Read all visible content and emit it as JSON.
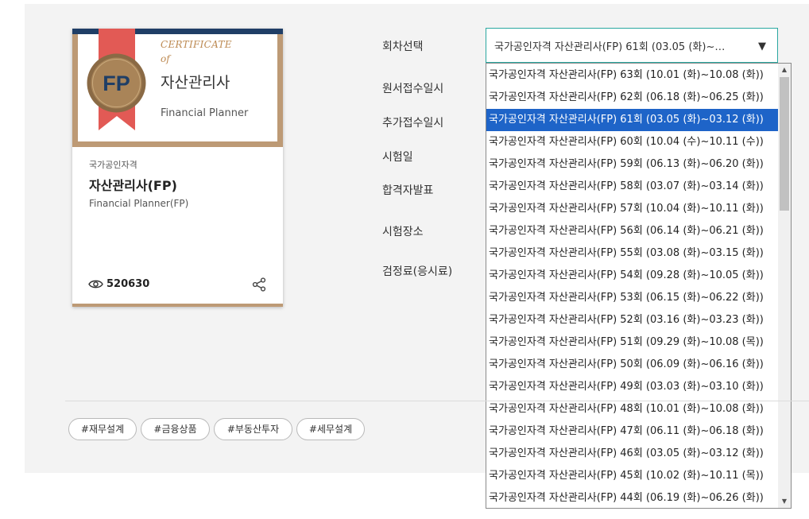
{
  "card": {
    "certificate_word": "CERTIFICATE",
    "of_word": "of",
    "seal_text": "FP",
    "title_ko": "자산관리사",
    "title_en": "Financial Planner",
    "category": "국가공인자격",
    "name": "자산관리사(FP)",
    "name_en": "Financial Planner(FP)",
    "views": "520630",
    "colors": {
      "navy": "#1f3e66",
      "gold": "#bd9a75",
      "ribbon": "#e25a55"
    }
  },
  "info_labels": [
    "회차선택",
    "원서접수일시",
    "추가접수일시",
    "시험일",
    "합격자발표",
    "시험장소",
    "검정료(응시료)"
  ],
  "round_select": {
    "selected_text": "국가공인자격 자산관리사(FP) 61회 (03.05 (화)~…",
    "options": [
      "국가공인자격 자산관리사(FP) 63회 (10.01 (화)~10.08 (화))",
      "국가공인자격 자산관리사(FP) 62회 (06.18 (화)~06.25 (화))",
      "국가공인자격 자산관리사(FP) 61회 (03.05 (화)~03.12 (화))",
      "국가공인자격 자산관리사(FP) 60회 (10.04 (수)~10.11 (수))",
      "국가공인자격 자산관리사(FP) 59회 (06.13 (화)~06.20 (화))",
      "국가공인자격 자산관리사(FP) 58회 (03.07 (화)~03.14 (화))",
      "국가공인자격 자산관리사(FP) 57회 (10.04 (화)~10.11 (화))",
      "국가공인자격 자산관리사(FP) 56회 (06.14 (화)~06.21 (화))",
      "국가공인자격 자산관리사(FP) 55회 (03.08 (화)~03.15 (화))",
      "국가공인자격 자산관리사(FP) 54회 (09.28 (화)~10.05 (화))",
      "국가공인자격 자산관리사(FP) 53회 (06.15 (화)~06.22 (화))",
      "국가공인자격 자산관리사(FP) 52회 (03.16 (화)~03.23 (화))",
      "국가공인자격 자산관리사(FP) 51회 (09.29 (화)~10.08 (목))",
      "국가공인자격 자산관리사(FP) 50회 (06.09 (화)~06.16 (화))",
      "국가공인자격 자산관리사(FP) 49회 (03.03 (화)~03.10 (화))",
      "국가공인자격 자산관리사(FP) 48회 (10.01 (화)~10.08 (화))",
      "국가공인자격 자산관리사(FP) 47회 (06.11 (화)~06.18 (화))",
      "국가공인자격 자산관리사(FP) 46회 (03.05 (화)~03.12 (화))",
      "국가공인자격 자산관리사(FP) 45회 (10.02 (화)~10.11 (목))",
      "국가공인자격 자산관리사(FP) 44회 (06.19 (화)~06.26 (화))"
    ],
    "selected_index": 2
  },
  "tags": [
    "#재무설계",
    "#금융상품",
    "#부동산투자",
    "#세무설계"
  ]
}
